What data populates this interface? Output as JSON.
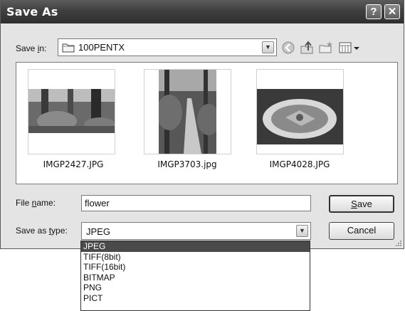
{
  "dialog": {
    "title": "Save As",
    "help_glyph": "?",
    "close_glyph": "✕"
  },
  "save_in": {
    "label_pre": "Save ",
    "label_key": "i",
    "label_post": "n:",
    "value": "100PENTX",
    "toolbar_icons": [
      "back-icon",
      "up-folder-icon",
      "new-folder-icon",
      "views-menu-icon"
    ]
  },
  "files": [
    {
      "name": "IMGP2427.JPG"
    },
    {
      "name": "IMGP3703.jpg"
    },
    {
      "name": "IMGP4028.JPG"
    }
  ],
  "file_name": {
    "label_pre": "File ",
    "label_key": "n",
    "label_post": "ame:",
    "value": "flower"
  },
  "save_type": {
    "label_pre": "Save as ",
    "label_key": "t",
    "label_post": "ype:",
    "value": "JPEG",
    "options": [
      "JPEG",
      "TIFF(8bit)",
      "TIFF(16bit)",
      "BITMAP",
      "PNG",
      "PICT"
    ],
    "selected_index": 0
  },
  "buttons": {
    "save_key": "S",
    "save_rest": "ave",
    "cancel": "Cancel"
  }
}
